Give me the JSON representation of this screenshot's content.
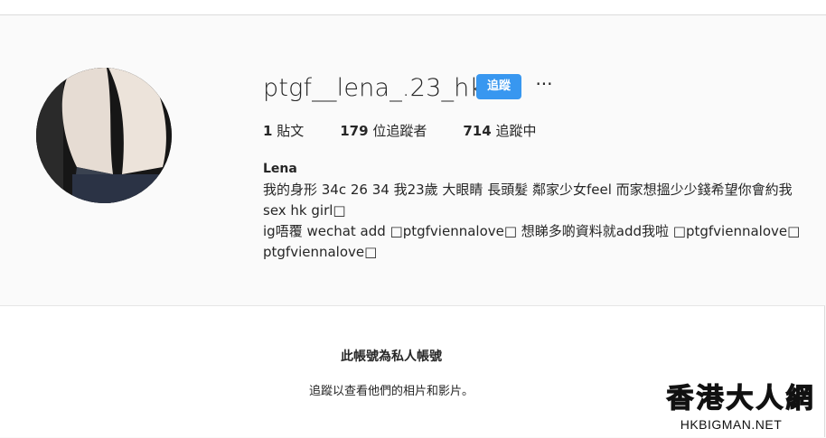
{
  "profile": {
    "username": "ptgf__lena_.23_hk",
    "follow_label": "追蹤",
    "more_label": "···",
    "stats": {
      "posts_count": "1",
      "posts_label": "貼文",
      "followers_count": "179",
      "followers_label": "位追蹤者",
      "following_count": "714",
      "following_label": "追蹤中"
    },
    "bio": {
      "name": "Lena",
      "lines": [
        "我的身形 34c 26 34 我23歲 大眼睛 長頭髮 鄰家少女feel 而家想搵少少錢希望你會約我",
        "sex hk girl□",
        "ig唔覆 wechat add □ptgfviennalove□ 想睇多啲資料就add我啦 □ptgfviennalove□",
        "ptgfviennalove□"
      ]
    }
  },
  "private_notice": {
    "title": "此帳號為私人帳號",
    "description": "追蹤以查看他們的相片和影片。"
  },
  "watermark": {
    "chinese": "香港大人網",
    "domain": "HKBIGMAN.NET"
  },
  "colors": {
    "follow_button": "#3897f0",
    "background": "#fafafa",
    "text": "#262626"
  }
}
